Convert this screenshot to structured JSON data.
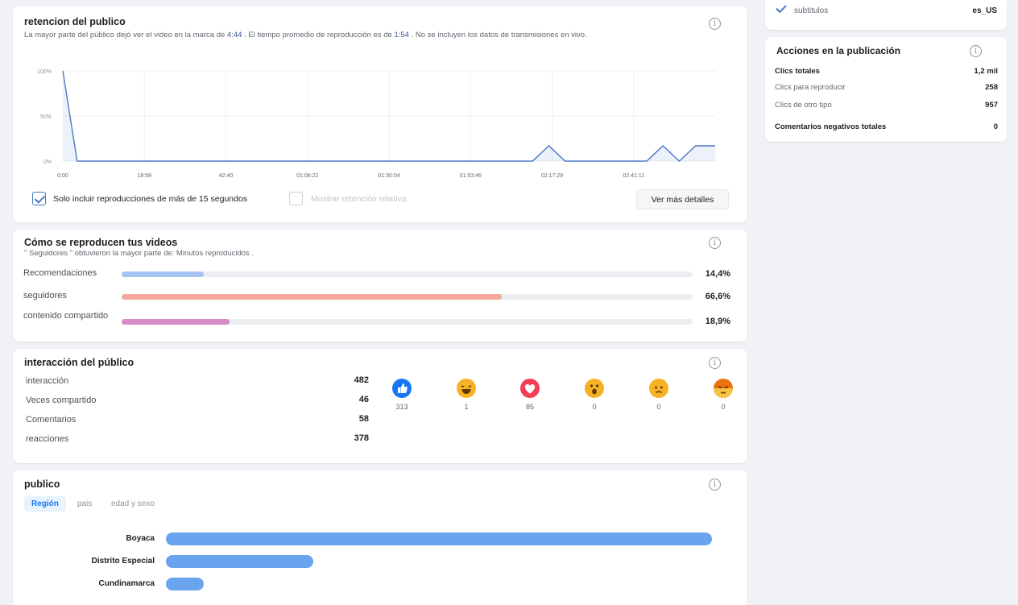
{
  "retention": {
    "title": "retencion del publico",
    "desc_part1": "La mayor parte del público dejó ver el video en la marca de ",
    "drop_time": "4:44",
    "desc_part2": " . El tiempo promedio de reproducción es de ",
    "avg_time": "1:54",
    "desc_part3": " . No se incluyen los datos de transmisiones en vivo.",
    "checkbox_only15_label": "Solo incluir reproducciones de más de 15 segundos",
    "checkbox_only15_checked": true,
    "checkbox_relative_label": "Mostrar retención relativa",
    "checkbox_relative_checked": false,
    "more_details_button": "Ver más detalles"
  },
  "chart_data": {
    "type": "area",
    "title": "",
    "xlabel": "",
    "ylabel": "",
    "y_ticks": [
      "100%",
      "50%",
      "0%"
    ],
    "x_ticks": [
      "0:00",
      "18:58",
      "42:40",
      "01:06:22",
      "01:30:04",
      "01:53:46",
      "02:17:29",
      "02:41:11"
    ],
    "ylim": [
      0,
      100
    ],
    "grid": true,
    "series": [
      {
        "color": "#4a78c6",
        "points": [
          [
            0.0,
            100
          ],
          [
            0.022,
            0
          ],
          [
            0.72,
            0
          ],
          [
            0.745,
            17
          ],
          [
            0.77,
            0
          ],
          [
            0.895,
            0
          ],
          [
            0.92,
            17
          ],
          [
            0.945,
            0
          ],
          [
            0.97,
            17
          ],
          [
            1.0,
            17
          ]
        ]
      }
    ]
  },
  "playback": {
    "title": "Cómo se reproducen tus videos",
    "subtitle": "\" Seguidores \" obtuvieron la mayor parte de: Minutos reproducidos .",
    "sources": [
      {
        "label": "Recomendaciones",
        "percent": 14.4,
        "display": "14,4%",
        "color": "#a8c4f5"
      },
      {
        "label": "seguidores",
        "percent": 66.6,
        "display": "66,6%",
        "color": "#f3a89a"
      },
      {
        "label": "contenido compartido",
        "percent": 18.9,
        "display": "18,9%",
        "color": "#d58cc8"
      }
    ]
  },
  "interaction": {
    "title": "interacción del público",
    "rows": [
      {
        "label": "interacción",
        "value": "482"
      },
      {
        "label": "Veces compartido",
        "value": "46"
      },
      {
        "label": "Comentarios",
        "value": "58"
      },
      {
        "label": "reacciones",
        "value": "378"
      }
    ],
    "reactions": [
      {
        "icon": "like-icon",
        "count": "313",
        "color": "#1877f2"
      },
      {
        "icon": "haha-icon",
        "count": "1",
        "color": "#f7b125"
      },
      {
        "icon": "love-icon",
        "count": "85",
        "color": "#f33e58"
      },
      {
        "icon": "wow-icon",
        "count": "0",
        "color": "#f7b125"
      },
      {
        "icon": "sad-icon",
        "count": "0",
        "color": "#f7b125"
      },
      {
        "icon": "angry-icon",
        "count": "0",
        "color": "#e9710f"
      }
    ]
  },
  "audience": {
    "title": "publico",
    "tabs": [
      "Región",
      "pais",
      "edad y sexo"
    ],
    "active_tab": "Región",
    "regions": [
      {
        "label": "Boyaca",
        "value": 100
      },
      {
        "label": "Distrito Especial",
        "value": 27
      },
      {
        "label": "Cundinamarca",
        "value": 7
      }
    ]
  },
  "sidebar": {
    "subtitles_label": "subtitulos",
    "subtitles_value": "es_US",
    "actions_title": "Acciones en la publicación",
    "actions": [
      {
        "label": "Clics totales",
        "value": "1,2 mil",
        "bold": true
      },
      {
        "label": "Clics para reproducir",
        "value": "258",
        "bold": false
      },
      {
        "label": "Clics de otro tipo",
        "value": "957",
        "bold": false
      },
      {
        "label": "Comentarios negativos totales",
        "value": "0",
        "bold": true
      }
    ]
  }
}
